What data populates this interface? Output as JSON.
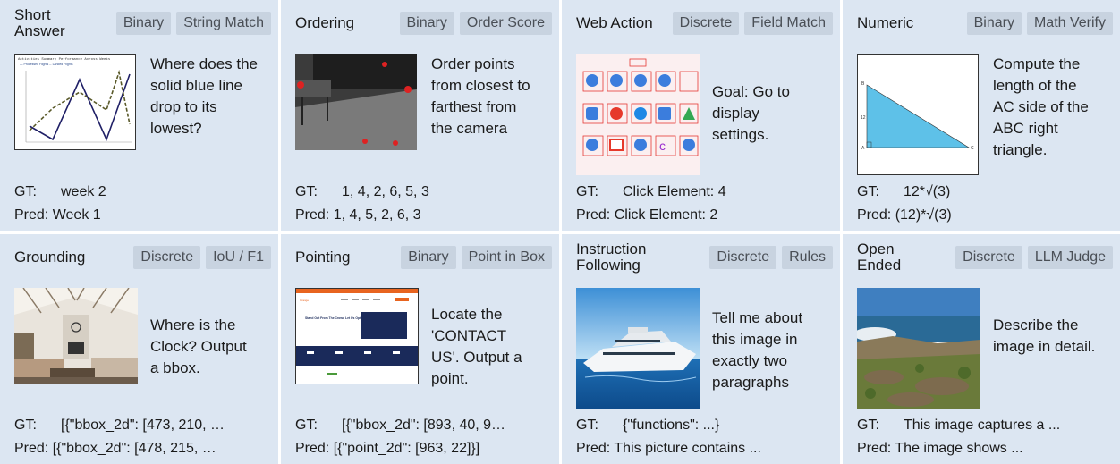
{
  "cards": [
    {
      "title": "Short Answer",
      "tag1": "Binary",
      "tag2": "String Match",
      "prompt": "Where does the solid blue line drop to its lowest?",
      "gt": "week 2",
      "pred": "Week 1"
    },
    {
      "title": "Ordering",
      "tag1": "Binary",
      "tag2": "Order Score",
      "prompt": "Order points from closest to farthest from the camera",
      "gt": "1, 4, 2, 6, 5, 3",
      "pred": "1, 4, 5, 2, 6, 3"
    },
    {
      "title": "Web Action",
      "tag1": "Discrete",
      "tag2": "Field Match",
      "prompt": "Goal: Go to display settings.",
      "gt": "Click Element: 4",
      "pred": "Click Element: 2"
    },
    {
      "title": "Numeric",
      "tag1": "Binary",
      "tag2": "Math Verify",
      "prompt": "Compute the length of the AC side of the ABC right triangle.",
      "gt": "12*√(3)",
      "pred": "(12)*√(3)"
    },
    {
      "title": "Grounding",
      "tag1": "Discrete",
      "tag2": "IoU / F1",
      "prompt": "Where is the Clock? Output a bbox.",
      "gt": "[{\"bbox_2d\": [473, 210, …",
      "pred": "[{\"bbox_2d\": [478, 215, …"
    },
    {
      "title": "Pointing",
      "tag1": "Binary",
      "tag2": "Point in Box",
      "prompt": "Locate the 'CONTACT US'. Output a point.",
      "gt": "[{\"bbox_2d\": [893, 40, 9…",
      "pred": "[{\"point_2d\": [963, 22]}]"
    },
    {
      "title": "Instruction Following",
      "tag1": "Discrete",
      "tag2": "Rules",
      "prompt": "Tell me about this image in exactly two paragraphs",
      "gt": "{\"functions\": ...}",
      "pred": "This picture contains ..."
    },
    {
      "title": "Open Ended",
      "tag1": "Discrete",
      "tag2": "LLM Judge",
      "prompt": "Describe the image in detail.",
      "gt": "This image captures a ...",
      "pred": "The image shows ..."
    }
  ],
  "labels": {
    "gt": "GT:",
    "pred": "Pred:"
  },
  "thumb_text": {
    "chart_title": "Activities Summary Performance Across Weeks",
    "chart_legend": "— Processed Flights  -- Landed Flights",
    "tri_b": "B",
    "tri_a": "A",
    "tri_c": "C",
    "tri_side": "12",
    "web_hdr": "Orange",
    "web_cta": "Stand Out From The Crowd Let Us Optimize Your Digital Presence!"
  },
  "colors": {
    "card_bg": "#dce6f2",
    "tag_bg": "#c8d3e0",
    "tag_text": "#4a4f56"
  }
}
